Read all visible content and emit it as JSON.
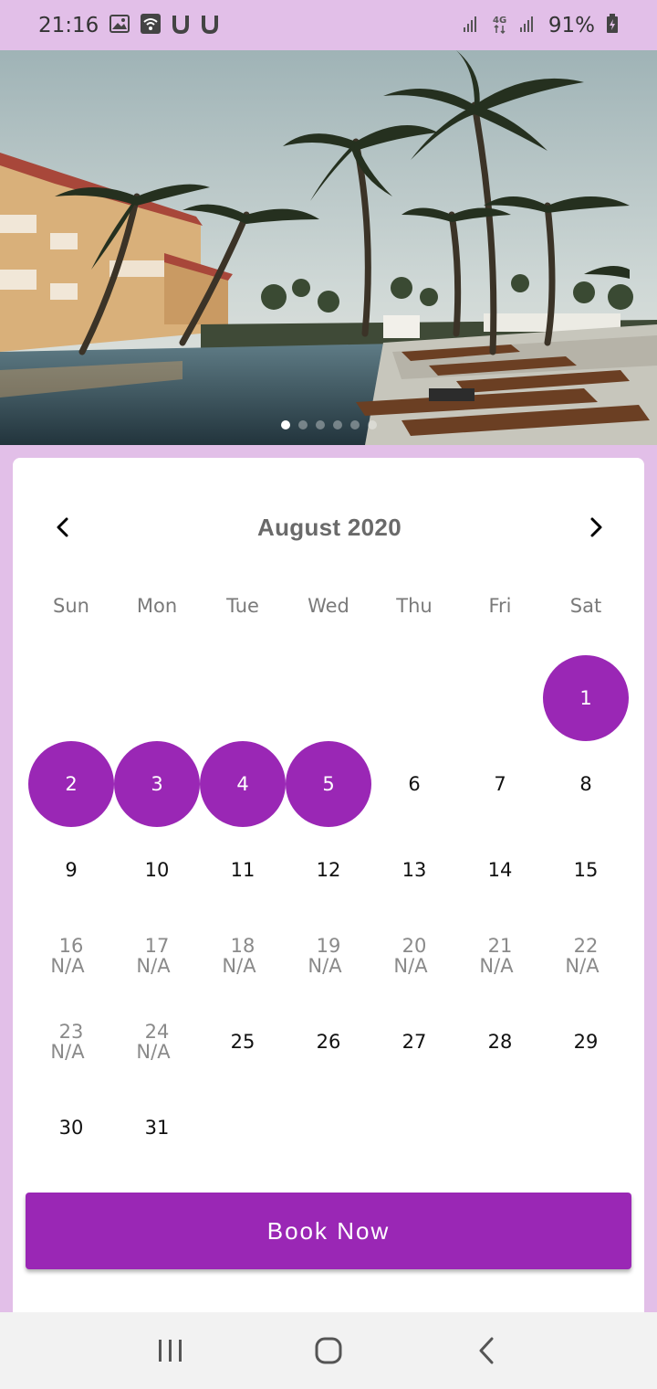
{
  "status": {
    "time": "21:16",
    "battery": "91%",
    "left_icons": [
      "gallery-icon",
      "wifi-hotspot-icon",
      "u-app-icon",
      "u-app-icon"
    ],
    "right_icons": [
      "signal-icon",
      "4g-icon",
      "signal-icon",
      "battery-icon"
    ]
  },
  "hero": {
    "slide_count": 6,
    "active_slide": 1
  },
  "calendar": {
    "month_label": "August 2020",
    "weekdays": [
      "Sun",
      "Mon",
      "Tue",
      "Wed",
      "Thu",
      "Fri",
      "Sat"
    ],
    "leading_blanks": 6,
    "days": [
      {
        "n": "1",
        "state": "selected"
      },
      {
        "n": "2",
        "state": "selected"
      },
      {
        "n": "3",
        "state": "selected"
      },
      {
        "n": "4",
        "state": "selected"
      },
      {
        "n": "5",
        "state": "selected"
      },
      {
        "n": "6",
        "state": "available"
      },
      {
        "n": "7",
        "state": "available"
      },
      {
        "n": "8",
        "state": "available"
      },
      {
        "n": "9",
        "state": "available"
      },
      {
        "n": "10",
        "state": "available"
      },
      {
        "n": "11",
        "state": "available"
      },
      {
        "n": "12",
        "state": "available"
      },
      {
        "n": "13",
        "state": "available"
      },
      {
        "n": "14",
        "state": "available"
      },
      {
        "n": "15",
        "state": "available"
      },
      {
        "n": "16",
        "state": "unavailable",
        "note": "N/A"
      },
      {
        "n": "17",
        "state": "unavailable",
        "note": "N/A"
      },
      {
        "n": "18",
        "state": "unavailable",
        "note": "N/A"
      },
      {
        "n": "19",
        "state": "unavailable",
        "note": "N/A"
      },
      {
        "n": "20",
        "state": "unavailable",
        "note": "N/A"
      },
      {
        "n": "21",
        "state": "unavailable",
        "note": "N/A"
      },
      {
        "n": "22",
        "state": "unavailable",
        "note": "N/A"
      },
      {
        "n": "23",
        "state": "unavailable",
        "note": "N/A"
      },
      {
        "n": "24",
        "state": "unavailable",
        "note": "N/A"
      },
      {
        "n": "25",
        "state": "available"
      },
      {
        "n": "26",
        "state": "available"
      },
      {
        "n": "27",
        "state": "available"
      },
      {
        "n": "28",
        "state": "available"
      },
      {
        "n": "29",
        "state": "available"
      },
      {
        "n": "30",
        "state": "available"
      },
      {
        "n": "31",
        "state": "available"
      }
    ],
    "prev_icon": "chevron-left-icon",
    "next_icon": "chevron-right-icon"
  },
  "actions": {
    "book_label": "Book Now"
  },
  "colors": {
    "accent": "#9a27b5",
    "background": "#e2bfe8"
  },
  "navbar": {
    "icons": [
      "recent-apps-icon",
      "home-icon",
      "back-icon"
    ]
  }
}
